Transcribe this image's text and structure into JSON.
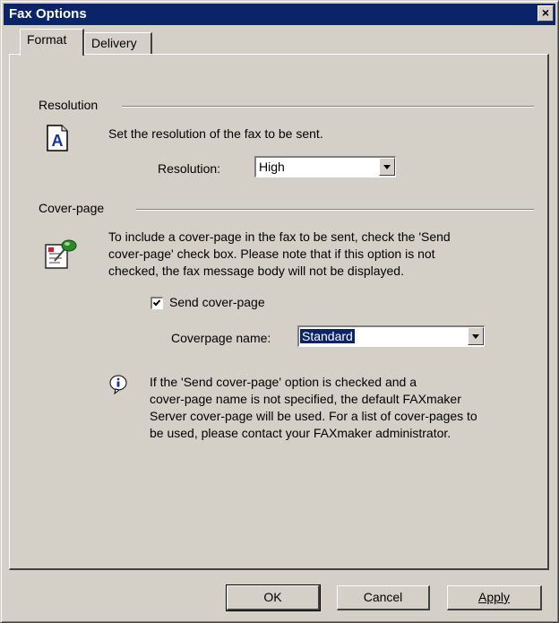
{
  "window": {
    "title": "Fax Options",
    "close_glyph": "×"
  },
  "tabs": [
    {
      "label": "Format",
      "active": true
    },
    {
      "label": "Delivery",
      "active": false
    }
  ],
  "resolution_group": {
    "label": "Resolution",
    "description": "Set the resolution of the fax to be sent.",
    "field_label": "Resolution:",
    "selected": "High",
    "icon": "document-a-icon"
  },
  "coverpage_group": {
    "label": "Cover-page",
    "description_lines": [
      "To include a cover-page in the fax to be sent, check the 'Send",
      "cover-page' check box. Please note that if this option is not",
      "checked, the fax message body will not be displayed."
    ],
    "checkbox_label": "Send cover-page",
    "checked": true,
    "name_label": "Coverpage name:",
    "name_value": "Standard",
    "icon": "coverpage-pushpin-icon"
  },
  "info": {
    "icon": "info-icon",
    "lines": [
      "If the 'Send cover-page' option is checked and a",
      "cover-page name is not specified, the default FAXmaker",
      "Server cover-page will be used. For a list of cover-pages to",
      "be used, please contact your FAXmaker administrator."
    ]
  },
  "buttons": {
    "ok": "OK",
    "cancel": "Cancel",
    "apply": "Apply"
  },
  "colors": {
    "titlebar": "#0a246a",
    "face": "#d4d0c8",
    "selection": "#0a246a"
  }
}
